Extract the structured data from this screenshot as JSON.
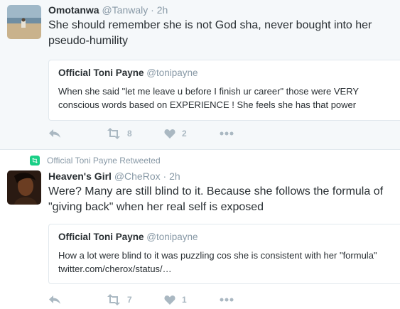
{
  "tweets": [
    {
      "name": "Omotanwa",
      "handle": "@Tanwaly",
      "time": "· 2h",
      "text": "She should remember she is not God sha, never bought into her pseudo-humility",
      "quote": {
        "name": "Official Toni Payne",
        "handle": "@tonipayne",
        "text": "When she said \"let me leave u before I finish ur career\" those were VERY conscious words based on EXPERIENCE ! She feels she has that power"
      },
      "retweets": "8",
      "likes": "2"
    },
    {
      "retweeted_by": "Official Toni Payne Retweeted",
      "name": "Heaven's Girl",
      "handle": "@CheRox",
      "time": "· 2h",
      "text": "Were? Many are still blind to it. Because she follows the formula of \"giving back\" when her real self is exposed",
      "quote": {
        "name": "Official Toni Payne",
        "handle": "@tonipayne",
        "text": "How a lot were blind to it was puzzling cos she is consistent with her \"formula\"  twitter.com/cherox/status/…"
      },
      "retweets": "7",
      "likes": "1"
    }
  ],
  "colors": {
    "background_top": "#f5f8fa",
    "text": "#292f33",
    "muted": "#8899a6",
    "icon": "#aab8c2",
    "retweet_green": "#19cf86",
    "border": "#e1e8ed"
  },
  "icons": [
    "reply-icon",
    "retweet-icon",
    "heart-icon",
    "more-icon"
  ]
}
